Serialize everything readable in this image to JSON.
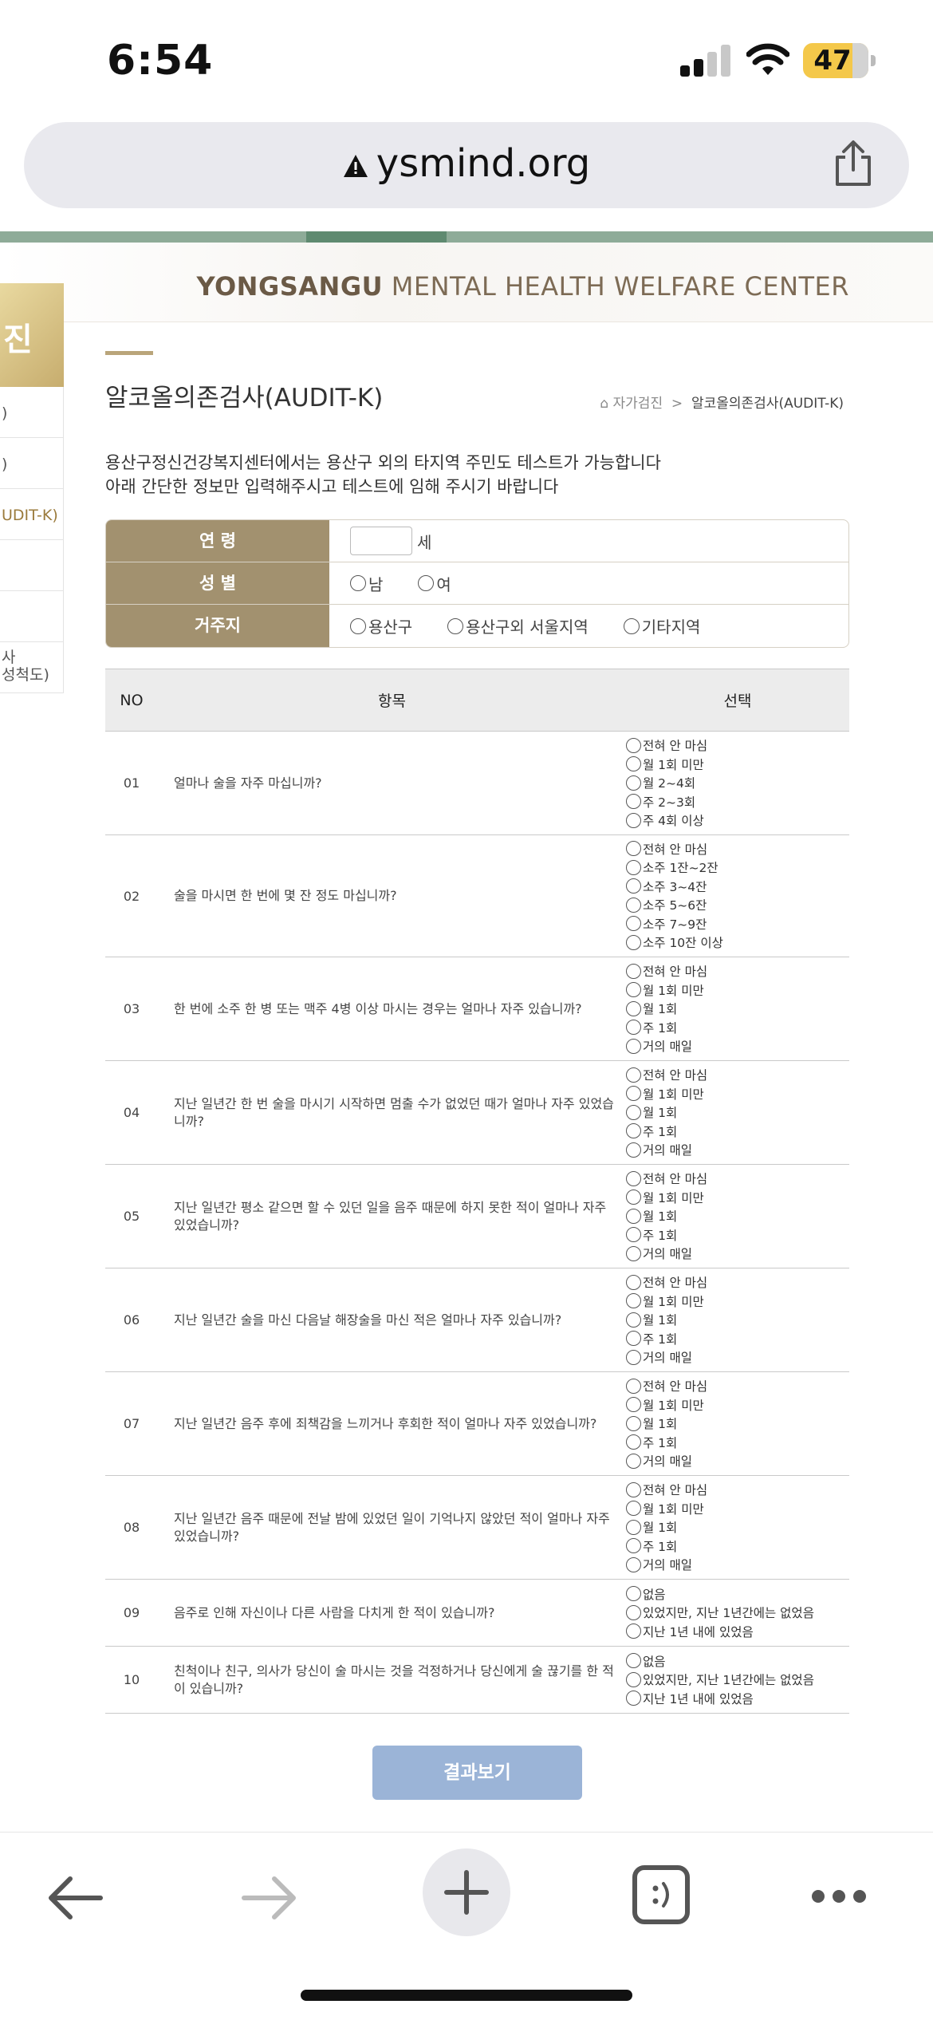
{
  "status_bar": {
    "time": "6:54",
    "battery": "47"
  },
  "browser": {
    "url": "ysmind.org"
  },
  "site": {
    "brand_bold": "YONGSANGU",
    "brand_rest": " MENTAL HEALTH WELFARE CENTER"
  },
  "sidebar": {
    "top_label": "진",
    "items": [
      ")",
      ")",
      "UDIT-K)",
      "",
      "",
      "사\n성척도)"
    ]
  },
  "page": {
    "title": "알코올의존검사(AUDIT-K)",
    "breadcrumb": {
      "parent": "자가검진",
      "separator": ">",
      "current": "알코올의존검사(AUDIT-K)"
    },
    "intro_line1": "용산구정신건강복지센터에서는 용산구 외의 타지역 주민도 테스트가 가능합니다",
    "intro_line2": "아래 간단한 정보만 입력해주시고 테스트에 임해 주시기 바랍니다"
  },
  "info_form": {
    "age_label": "연 령",
    "age_value": "",
    "age_unit": "세",
    "gender_label": "성 별",
    "gender_options": [
      "남",
      "여"
    ],
    "residence_label": "거주지",
    "residence_options": [
      "용산구",
      "용산구외 서울지역",
      "기타지역"
    ]
  },
  "table": {
    "headers": {
      "no": "NO",
      "item": "항목",
      "choice": "선택"
    },
    "questions": [
      {
        "no": "01",
        "text": "얼마나 술을 자주 마십니까?",
        "options": [
          "전혀 안 마심",
          "월 1회 미만",
          "월 2~4회",
          "주 2~3회",
          "주 4회 이상"
        ]
      },
      {
        "no": "02",
        "text": "술을 마시면 한 번에 몇 잔 정도 마십니까?",
        "options": [
          "전혀 안 마심",
          "소주 1잔~2잔",
          "소주 3~4잔",
          "소주 5~6잔",
          "소주 7~9잔",
          "소주 10잔 이상"
        ]
      },
      {
        "no": "03",
        "text": "한 번에 소주 한 병 또는 맥주 4병 이상 마시는 경우는 얼마나 자주 있습니까?",
        "options": [
          "전혀 안 마심",
          "월 1회 미만",
          "월 1회",
          "주 1회",
          "거의 매일"
        ]
      },
      {
        "no": "04",
        "text": "지난 일년간 한 번 술을 마시기 시작하면 멈출 수가 없었던 때가 얼마나 자주 있었습니까?",
        "options": [
          "전혀 안 마심",
          "월 1회 미만",
          "월 1회",
          "주 1회",
          "거의 매일"
        ]
      },
      {
        "no": "05",
        "text": "지난 일년간 평소 같으면 할 수 있던 일을 음주 때문에 하지 못한 적이 얼마나 자주 있었습니까?",
        "options": [
          "전혀 안 마심",
          "월 1회 미만",
          "월 1회",
          "주 1회",
          "거의 매일"
        ]
      },
      {
        "no": "06",
        "text": "지난 일년간 술을 마신 다음날 해장술을 마신 적은 얼마나 자주 있습니까?",
        "options": [
          "전혀 안 마심",
          "월 1회 미만",
          "월 1회",
          "주 1회",
          "거의 매일"
        ]
      },
      {
        "no": "07",
        "text": "지난 일년간 음주 후에 죄책감을 느끼거나 후회한 적이 얼마나 자주 있었습니까?",
        "options": [
          "전혀 안 마심",
          "월 1회 미만",
          "월 1회",
          "주 1회",
          "거의 매일"
        ]
      },
      {
        "no": "08",
        "text": "지난 일년간 음주 때문에 전날 밤에 있었던 일이 기억나지 않았던 적이 얼마나 자주 있었습니까?",
        "options": [
          "전혀 안 마심",
          "월 1회 미만",
          "월 1회",
          "주 1회",
          "거의 매일"
        ]
      },
      {
        "no": "09",
        "text": "음주로 인해 자신이나 다른 사람을 다치게 한 적이 있습니까?",
        "options": [
          "없음",
          "있었지만, 지난 1년간에는 없었음",
          "지난 1년 내에 있었음"
        ]
      },
      {
        "no": "10",
        "text": "친척이나 친구, 의사가 당신이 술 마시는 것을 걱정하거나 당신에게 술 끊기를 한 적이 있습니까?",
        "options": [
          "없음",
          "있었지만, 지난 1년간에는 없었음",
          "지난 1년 내에 있었음"
        ]
      }
    ]
  },
  "result_button": "결과보기",
  "colors": {
    "header_label_bg": "#a2916f",
    "result_button_bg": "#9bb4d7",
    "accent_green": "#8eab98"
  }
}
